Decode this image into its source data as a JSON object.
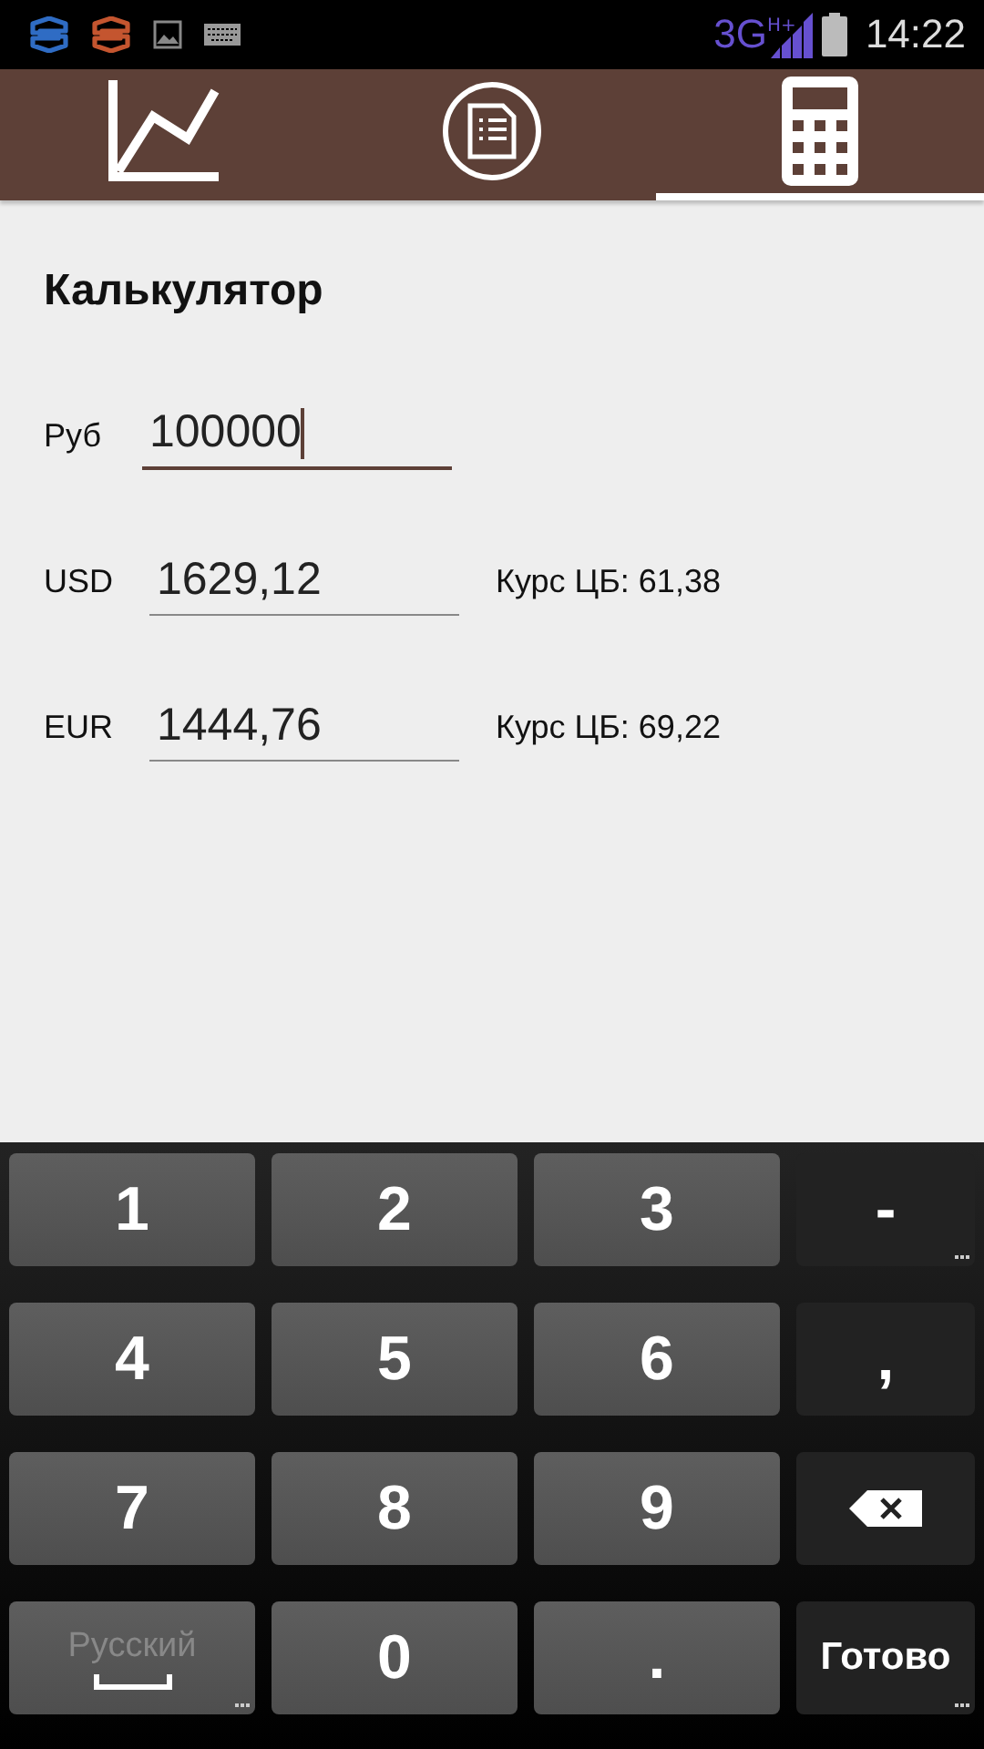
{
  "status_bar": {
    "network": "3G",
    "network_sub": "H+",
    "time": "14:22"
  },
  "tabs": [
    {
      "kind": "chart",
      "selected": false
    },
    {
      "kind": "document",
      "selected": false
    },
    {
      "kind": "calculator",
      "selected": true
    }
  ],
  "title": "Калькулятор",
  "rows": [
    {
      "label": "Руб",
      "value": "100000",
      "focused": true,
      "rate": null
    },
    {
      "label": "USD",
      "value": "1629,12",
      "focused": false,
      "rate": "Курс ЦБ: 61,38"
    },
    {
      "label": "EUR",
      "value": "1444,76",
      "focused": false,
      "rate": "Курс ЦБ: 69,22"
    }
  ],
  "keyboard": [
    [
      {
        "kind": "digit",
        "label": "1"
      },
      {
        "kind": "digit",
        "label": "2"
      },
      {
        "kind": "digit",
        "label": "3"
      },
      {
        "kind": "function",
        "label": "-",
        "more": true
      }
    ],
    [
      {
        "kind": "digit",
        "label": "4"
      },
      {
        "kind": "digit",
        "label": "5"
      },
      {
        "kind": "digit",
        "label": "6"
      },
      {
        "kind": "function",
        "label": ",",
        "more": false
      }
    ],
    [
      {
        "kind": "digit",
        "label": "7"
      },
      {
        "kind": "digit",
        "label": "8"
      },
      {
        "kind": "digit",
        "label": "9"
      },
      {
        "kind": "backspace"
      }
    ],
    [
      {
        "kind": "space",
        "label": "Русский",
        "more": true
      },
      {
        "kind": "digit",
        "label": "0"
      },
      {
        "kind": "function_light",
        "label": ".",
        "more": false
      },
      {
        "kind": "done",
        "label": "Готово",
        "more": true
      }
    ]
  ]
}
